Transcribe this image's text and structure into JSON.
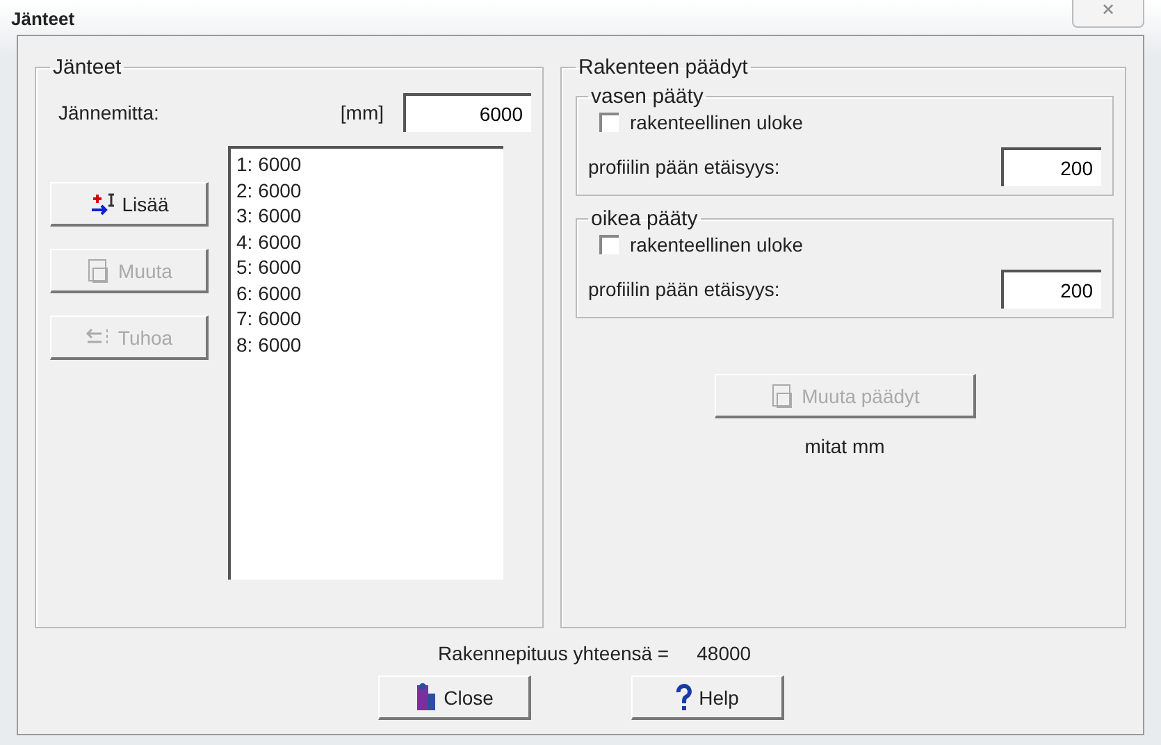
{
  "window": {
    "title": "Jänteet",
    "close": "✕"
  },
  "spans": {
    "title": "Jänteet",
    "length_label": "Jännemitta:",
    "unit": "[mm]",
    "length_value": "6000",
    "buttons": [
      {
        "kind": "add",
        "label": "Lisää",
        "disabled": false
      },
      {
        "kind": "edit",
        "label": "Muuta",
        "disabled": true
      },
      {
        "kind": "delete",
        "label": "Tuhoa",
        "disabled": true
      }
    ],
    "list": [
      "1: 6000",
      "2: 6000",
      "3: 6000",
      "4: 6000",
      "5: 6000",
      "6: 6000",
      "7: 6000",
      "8: 6000"
    ]
  },
  "ends": {
    "title": "Rakenteen päädyt",
    "groups": [
      {
        "title": "vasen pääty",
        "checkbox": "rakenteellinen uloke",
        "checked": false,
        "distance_label": "profiilin pään etäisyys:",
        "distance": "200"
      },
      {
        "title": "oikea pääty",
        "checkbox": "rakenteellinen uloke",
        "checked": false,
        "distance_label": "profiilin pään etäisyys:",
        "distance": "200"
      }
    ],
    "button": {
      "label": "Muuta päädyt",
      "disabled": true
    },
    "note": "mitat mm"
  },
  "total": {
    "label": "Rakennepituus yhteensä =",
    "value": "48000"
  },
  "footer": [
    {
      "kind": "close",
      "label": "Close"
    },
    {
      "kind": "help",
      "label": "Help"
    }
  ]
}
